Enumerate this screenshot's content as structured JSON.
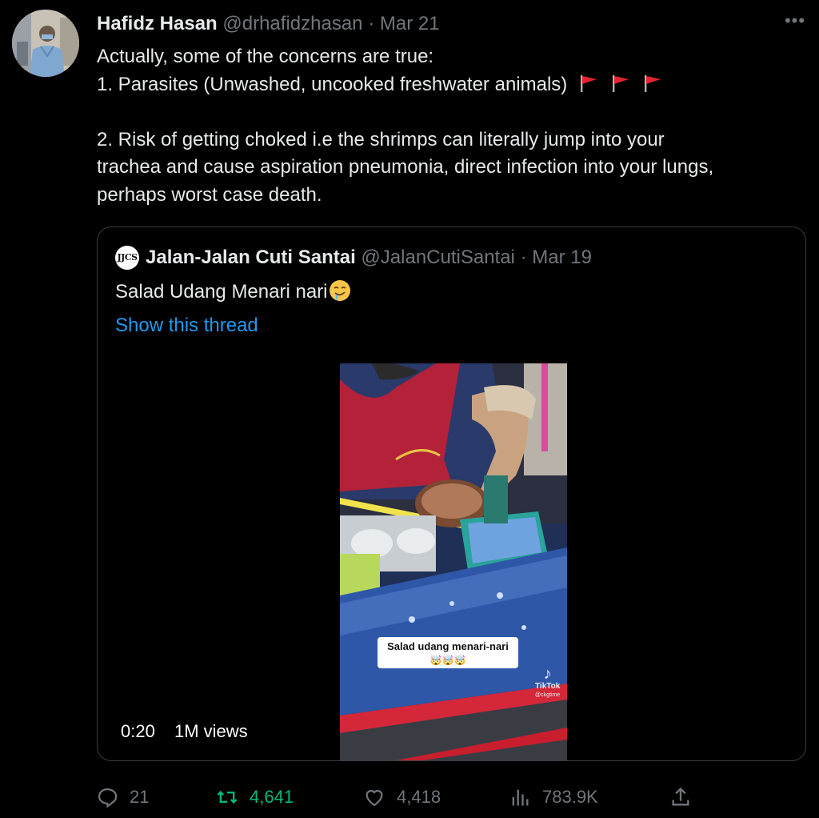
{
  "tweet": {
    "author_name": "Hafidz Hasan",
    "author_handle": "@drhafidzhasan",
    "separator": "·",
    "date": "Mar 21",
    "more_label": "•••",
    "lines": [
      "Actually, some of the concerns are true:",
      "1. Parasites (Unwashed, uncooked freshwater animals)",
      "2. Risk of getting choked i.e the shrimps can literally jump into your",
      "trachea and cause aspiration pneumonia, direct infection into your lungs,",
      "perhaps worst case death."
    ]
  },
  "quote": {
    "avatar_text": "JJCS",
    "author_name": "Jalan-Jalan Cuti Santai",
    "author_handle": "@JalanCutiSantai",
    "separator": "·",
    "date": "Mar 19",
    "text": "Salad Udang Menari nari",
    "show_thread": "Show this thread",
    "video": {
      "caption": "Salad udang menari-nari",
      "caption_emoji": "🤯🤯🤯",
      "watermark": "TikTok",
      "watermark_user": "@ckgtime",
      "duration": "0:20",
      "views": "1M views"
    }
  },
  "actions": {
    "replies": "21",
    "retweets": "4,641",
    "likes": "4,418",
    "views": "783.9K"
  },
  "colors": {
    "background": "#000000",
    "text": "#e7e9ea",
    "secondary": "#71767b",
    "link": "#1d9bf0",
    "retweet": "#00ba7c",
    "border": "#3a3d41"
  }
}
